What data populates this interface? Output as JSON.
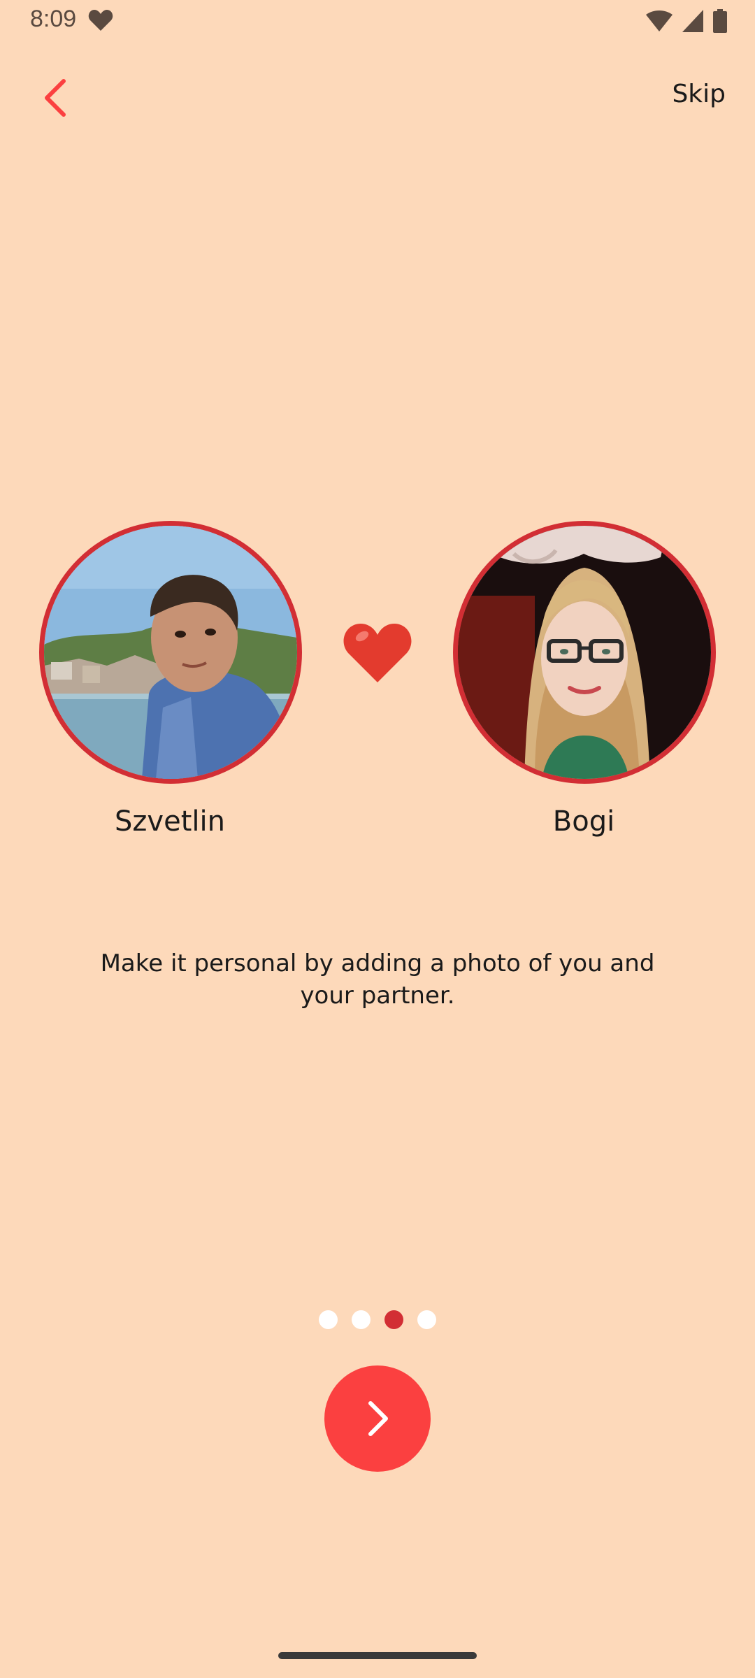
{
  "status_bar": {
    "time": "8:09",
    "icons": [
      "heart-icon",
      "wifi-icon",
      "signal-icon",
      "battery-icon"
    ]
  },
  "header": {
    "back_icon": "chevron-left-icon",
    "skip_label": "Skip"
  },
  "partners": {
    "left_name": "Szvetlin",
    "right_name": "Bogi",
    "separator_icon": "heart-emoji-icon"
  },
  "description": "Make it personal by adding a photo of you and your partner.",
  "pagination": {
    "total": 4,
    "active_index": 2
  },
  "next_icon": "chevron-right-icon",
  "colors": {
    "background": "#FDD9BA",
    "accent": "#FB4040",
    "avatar_border": "#D22E34",
    "dot_inactive": "#FFFFFF",
    "dot_active": "#D22E34"
  }
}
